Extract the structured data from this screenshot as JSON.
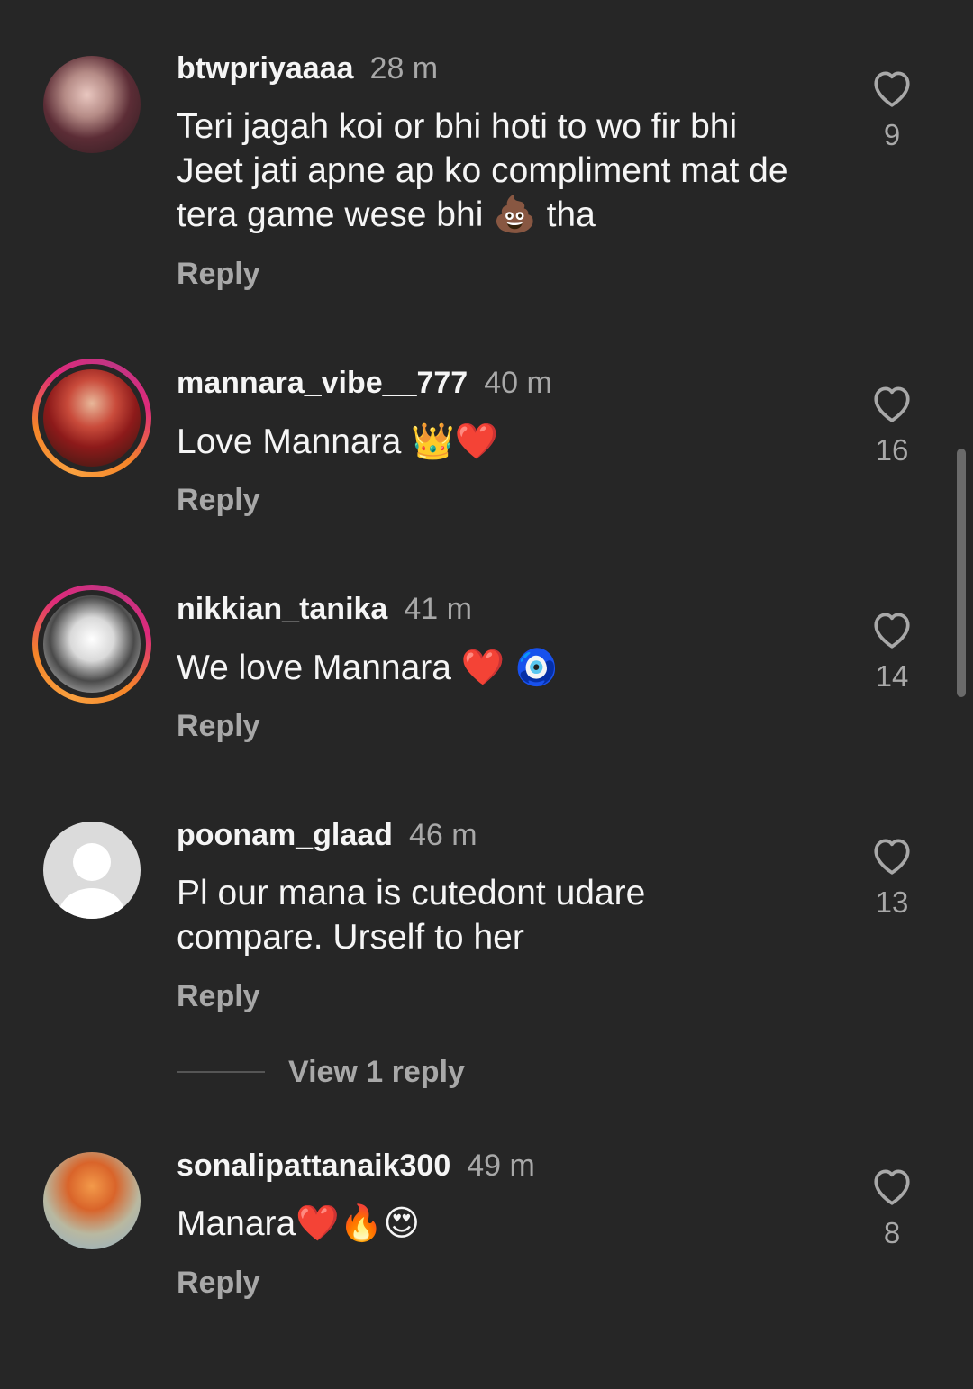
{
  "comments": [
    {
      "username": "btwpriyaaaa",
      "time": "28 m",
      "text": "Teri jagah koi or bhi hoti to wo fir bhi Jeet jati apne ap ko compliment mat de tera game wese bhi 💩 tha",
      "reply_label": "Reply",
      "likes": "9",
      "avatar": "profile-photo",
      "story_ring": false
    },
    {
      "username": "mannara_vibe__777",
      "time": "40 m",
      "text": "Love Mannara 👑❤️",
      "reply_label": "Reply",
      "likes": "16",
      "avatar": "profile-photo",
      "story_ring": true
    },
    {
      "username": "nikkian_tanika",
      "time": "41 m",
      "text": "We love Mannara ❤️ 🧿",
      "reply_label": "Reply",
      "likes": "14",
      "avatar": "profile-photo",
      "story_ring": true
    },
    {
      "username": "poonam_glaad",
      "time": "46 m",
      "text": "Pl our mana is cutedont udare compare. Urself to her",
      "reply_label": "Reply",
      "likes": "13",
      "avatar": "default-avatar",
      "story_ring": false
    },
    {
      "username": "sonalipattanaik300",
      "time": "49 m",
      "text": "Manara❤️🔥😍",
      "reply_label": "Reply",
      "likes": "8",
      "avatar": "profile-photo",
      "story_ring": false
    }
  ],
  "view_replies_label": "View 1 reply",
  "icons": {
    "like": "heart-outline-icon"
  },
  "colors": {
    "background": "#262626",
    "primary_text": "#f5f5f5",
    "secondary_text": "#a8a8a8",
    "story_ring_gradient": [
      "#f58529",
      "#dd2a7b"
    ]
  }
}
